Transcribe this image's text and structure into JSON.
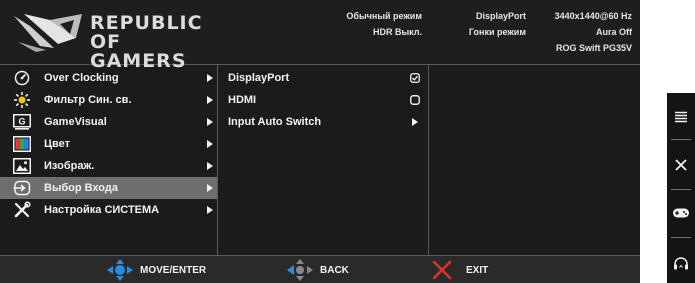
{
  "header": {
    "logo_line1": "REPUBLIC OF",
    "logo_line2": "GAMERS",
    "col1": [
      "Обычный режим",
      "HDR Выкл."
    ],
    "col2": [
      "DisplayPort",
      "Гонки режим"
    ],
    "col3": [
      "3440x1440@60 Hz",
      "Aura Off",
      "ROG Swift PG35V"
    ]
  },
  "main_menu": [
    {
      "label": "Over Clocking",
      "icon": "overclock-gauge-icon"
    },
    {
      "label": "Фильтр Син. св.",
      "icon": "blue-light-filter-icon"
    },
    {
      "label": "GameVisual",
      "icon": "gamevisual-icon"
    },
    {
      "label": "Цвет",
      "icon": "color-icon"
    },
    {
      "label": "Изображ.",
      "icon": "image-icon"
    },
    {
      "label": "Выбор Входа",
      "icon": "input-select-icon"
    },
    {
      "label": "Настройка СИСТЕМА",
      "icon": "system-setup-icon"
    }
  ],
  "submenu": [
    {
      "label": "DisplayPort",
      "control": "checked-box"
    },
    {
      "label": "HDMI",
      "control": "empty-box"
    },
    {
      "label": "Input Auto Switch",
      "control": "arrow"
    }
  ],
  "footer": {
    "move": "MOVE/ENTER",
    "back": "BACK",
    "exit": "EXIT"
  },
  "quick_keys": [
    "menu-icon",
    "close-icon",
    "gamepad-icon",
    "headphone-icon"
  ],
  "colors": {
    "osd_bg": "#1b1b1b",
    "selection": "#6e6e6e",
    "nav_blue": "#2a8ee0",
    "exit_red": "#e0322b",
    "text": "#f2f2f2"
  }
}
